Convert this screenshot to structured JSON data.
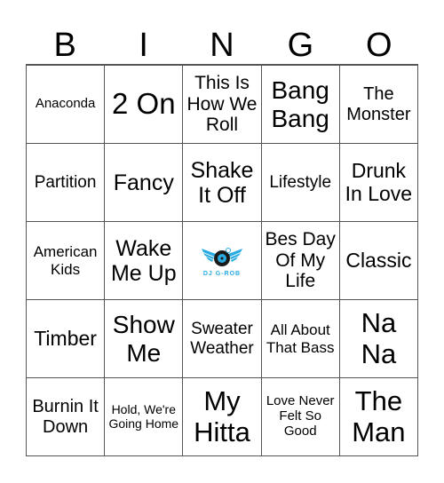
{
  "header": {
    "letters": [
      "B",
      "I",
      "N",
      "G",
      "O"
    ]
  },
  "free_space": {
    "logo_text": "DJ G-ROB",
    "icon": "turntable-wings-logo-icon",
    "color": "#29abe2"
  },
  "cells": [
    "Anaconda",
    "2 On",
    "This Is How We Roll",
    "Bang Bang",
    "The Monster",
    "Partition",
    "Fancy",
    "Shake It Off",
    "Lifestyle",
    "Drunk In Love",
    "American Kids",
    "Wake Me Up",
    "",
    "Bes Day Of My Life",
    "Classic",
    "Timber",
    "Show Me",
    "Sweater Weather",
    "All About That Bass",
    "Na Na",
    "Burnin It Down",
    "Hold, We're Going Home",
    "My Hitta",
    "Love Never Felt So Good",
    "The Man"
  ]
}
